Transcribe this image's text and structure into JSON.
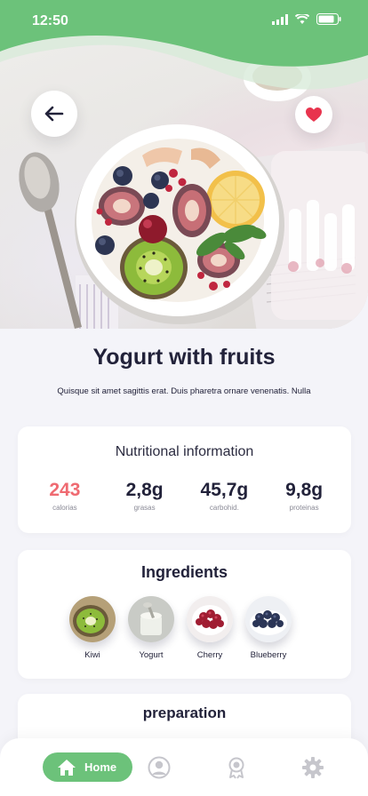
{
  "status_bar": {
    "time": "12:50"
  },
  "recipe": {
    "title": "Yogurt with fruits",
    "description": "Quisque sit amet sagittis erat. Duis pharetra ornare venenatis. Nulla"
  },
  "nutrition": {
    "title": "Nutritional information",
    "items": [
      {
        "value": "243",
        "label": "calorias"
      },
      {
        "value": "2,8g",
        "label": "grasas"
      },
      {
        "value": "45,7g",
        "label": "carbohid."
      },
      {
        "value": "9,8g",
        "label": "proteinas"
      }
    ]
  },
  "ingredients": {
    "title": "Ingredients",
    "items": [
      {
        "label": "Kiwi"
      },
      {
        "label": "Yogurt"
      },
      {
        "label": "Cherry"
      },
      {
        "label": "Blueberry"
      }
    ]
  },
  "preparation": {
    "title": "preparation"
  },
  "tabbar": {
    "home_label": "Home"
  },
  "colors": {
    "accent": "#6cc27a",
    "highlight": "#ef6a71",
    "heart": "#e8344e",
    "text": "#22223a"
  }
}
